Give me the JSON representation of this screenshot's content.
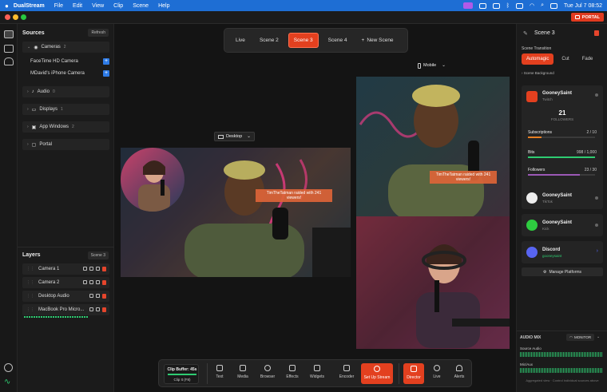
{
  "menubar": {
    "app": "DualStream",
    "menus": [
      "File",
      "Edit",
      "View",
      "Clip",
      "Scene",
      "Help"
    ],
    "clock": "Tue Jul 7  08:52"
  },
  "titlebar": {
    "portal_label": "PORTAL"
  },
  "sources": {
    "title": "Sources",
    "refresh_label": "Refresh",
    "groups": [
      {
        "label": "Cameras",
        "count": "2"
      },
      {
        "label": "Audio",
        "count": "0"
      },
      {
        "label": "Displays",
        "count": "1"
      },
      {
        "label": "App Windows",
        "count": "2"
      },
      {
        "label": "Portal",
        "count": ""
      }
    ],
    "cameras": [
      "FaceTime HD Camera",
      "MDavid's iPhone Camera"
    ]
  },
  "layers": {
    "title": "Layers",
    "scene_badge": "Scene 3",
    "items": [
      "Camera 1",
      "Camera 2",
      "Desktop Audio",
      "MacBook Pro Micro..."
    ]
  },
  "scene_tabs": [
    "Live",
    "Scene 2",
    "Scene 3",
    "Scene 4",
    "New Scene"
  ],
  "active_scene": "Scene 3",
  "canvas": {
    "desktop_label": "Desktop",
    "mobile_label": "Mobile",
    "raid_desktop": "TimTheTatman raided with 241 viewers!",
    "raid_mobile": "TimTheTatman raided with 241 viewers!"
  },
  "toolbar": {
    "clip_buffer": "Clip Buffer: 45s",
    "clip_it": "Clip It (F8)",
    "tools": [
      "Text",
      "Media",
      "Browser",
      "Effects",
      "Widgets",
      "Encoder"
    ],
    "setup_label": "Set Up Stream",
    "modes": [
      "Director",
      "Live",
      "Alerts"
    ]
  },
  "right": {
    "scene_title": "Scene 3",
    "transition_label": "Scene Transition",
    "transitions": [
      "Automagic",
      "Cut",
      "Fade"
    ],
    "background_label": "Scene Background",
    "youtube": {
      "name": "GooneySaint",
      "platform": "Twitch",
      "followers_count": "21",
      "followers_label": "FOLLOWERS",
      "bars": [
        {
          "label": "Subscriptions",
          "value": "2 / 10",
          "fraction": 0.2,
          "color": "#e67e22"
        },
        {
          "label": "Bits",
          "value": "998 / 1,000",
          "fraction": 0.998,
          "color": "#2ecc71"
        },
        {
          "label": "Followers",
          "value": "23 / 30",
          "fraction": 0.77,
          "color": "#9b59b6"
        }
      ]
    },
    "platforms": [
      {
        "name": "GooneySaint",
        "sub": "TikTok"
      },
      {
        "name": "GooneySaint",
        "sub": "Kick"
      },
      {
        "name": "Discord",
        "sub": "gooneysaint"
      }
    ],
    "manage_label": "Manage Platforms",
    "audio_mix_label": "AUDIO MIX",
    "monitor_label": "MONITOR",
    "channels": [
      "Source Audio",
      "Mic/Aux"
    ],
    "footer_note": "Aggregated view · Control individual sources above"
  }
}
